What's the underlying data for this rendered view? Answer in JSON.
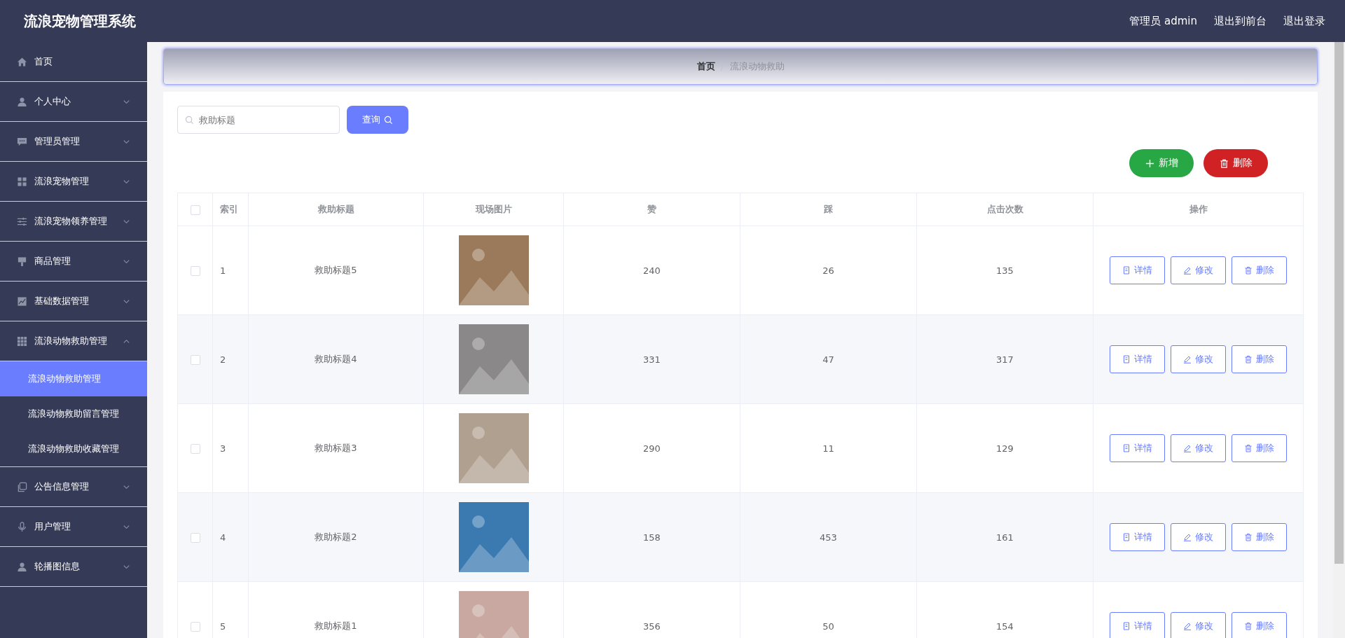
{
  "header": {
    "title": "流浪宠物管理系统",
    "links": [
      "管理员 admin",
      "退出到前台",
      "退出登录"
    ]
  },
  "sidebar": {
    "items": [
      {
        "label": "首页"
      },
      {
        "label": "个人中心",
        "expanded": false
      },
      {
        "label": "管理员管理",
        "expanded": false
      },
      {
        "label": "流浪宠物管理",
        "expanded": false
      },
      {
        "label": "流浪宠物领养管理",
        "expanded": false
      },
      {
        "label": "商品管理",
        "expanded": false
      },
      {
        "label": "基础数据管理",
        "expanded": false
      },
      {
        "label": "流浪动物救助管理",
        "expanded": true,
        "children": [
          {
            "label": "流浪动物救助管理",
            "selected": true
          },
          {
            "label": "流浪动物救助留言管理",
            "selected": false
          },
          {
            "label": "流浪动物救助收藏管理",
            "selected": false
          }
        ]
      },
      {
        "label": "公告信息管理",
        "expanded": false
      },
      {
        "label": "用户管理",
        "expanded": false
      },
      {
        "label": "轮播图信息",
        "expanded": false
      }
    ]
  },
  "breadcrumb": [
    "首页",
    "流浪动物救助"
  ],
  "search": {
    "placeholder": "救助标题",
    "button": "查询"
  },
  "actions": {
    "add": "新增",
    "delete": "删除"
  },
  "table": {
    "all_checked": false,
    "columns": [
      "索引",
      "救助标题",
      "现场图片",
      "赞",
      "踩",
      "点击次数",
      "操作"
    ],
    "rows": [
      {
        "index": "1",
        "title": "救助标题5",
        "likes": "240",
        "dislikes": "26",
        "clicks": "135",
        "checked": false,
        "buttons": [
          "详情",
          "修改",
          "删除"
        ]
      },
      {
        "index": "2",
        "title": "救助标题4",
        "likes": "331",
        "dislikes": "47",
        "clicks": "317",
        "checked": false,
        "buttons": [
          "详情",
          "修改",
          "删除"
        ]
      },
      {
        "index": "3",
        "title": "救助标题3",
        "likes": "290",
        "dislikes": "11",
        "clicks": "129",
        "checked": false,
        "buttons": [
          "详情",
          "修改",
          "删除"
        ]
      },
      {
        "index": "4",
        "title": "救助标题2",
        "likes": "158",
        "dislikes": "453",
        "clicks": "161",
        "checked": false,
        "buttons": [
          "详情",
          "修改",
          "删除"
        ]
      },
      {
        "index": "5",
        "title": "救助标题1",
        "likes": "356",
        "dislikes": "50",
        "clicks": "154",
        "checked": false,
        "buttons": [
          "详情",
          "修改",
          "删除"
        ]
      }
    ]
  }
}
